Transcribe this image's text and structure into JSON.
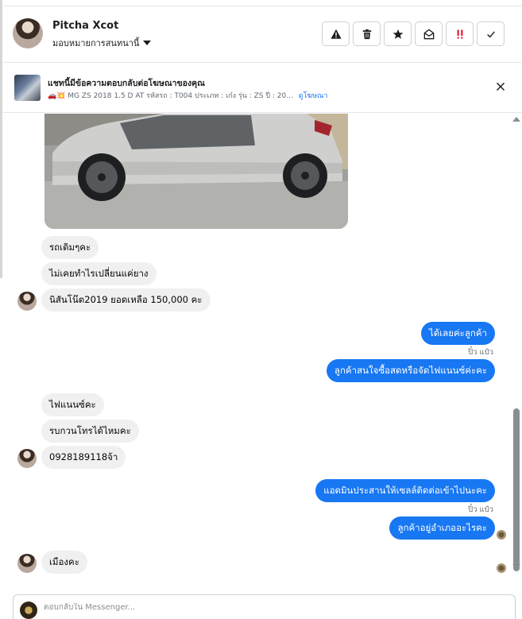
{
  "header": {
    "contact_name": "Pitcha Xcot",
    "assign_label": "มอบหมายการสนทนานี้",
    "actions": [
      {
        "name": "spam-button",
        "icon": "warning-icon"
      },
      {
        "name": "delete-button",
        "icon": "trash-icon"
      },
      {
        "name": "star-button",
        "icon": "star-icon"
      },
      {
        "name": "mark-unread-button",
        "icon": "envelope-open-icon"
      },
      {
        "name": "follow-up-button",
        "icon": "double-exclamation-icon",
        "color": "#e41e3f"
      },
      {
        "name": "done-button",
        "icon": "check-icon"
      }
    ]
  },
  "ad_banner": {
    "title": "แชทนี้มีข้อความตอบกลับต่อโฆษณาของคุณ",
    "description": "🚗💥 MG ZS 2018 1.5 D AT รหัสรถ : T004 ประเภท : เก๋ง รุ่น : ZS ปี : 20...",
    "link_label": "ดูโฆษณา"
  },
  "messages": {
    "m1": "รถเดิมๆคะ",
    "m2": "ไม่เคยทำไรเปลี่ยนแค่ยาง",
    "m3": "นิสันโน๊ต2019 ยอดเหลือ 150,000 คะ",
    "m4": "ได้เลยค่ะลูกค้า",
    "seen1": "ปิ๋ว แป๋ว",
    "m5": "ลูกค้าสนใจซื้อสดหรือจัดไฟแนนซ์ค่ะคะ",
    "m6": "ไฟแนนซ์คะ",
    "m7": "รบกวนโทรได้ไหมคะ",
    "m8": "0928189118จ้า",
    "m9": "แอดมินประสานให้เซลล์ติดต่อเข้าไปนะคะ",
    "seen2": "ปิ๋ว แป๋ว",
    "m10": "ลูกค้าอยู่อำเภออะไรคะ",
    "m11": "เมืองคะ"
  },
  "reply": {
    "placeholder": "ตอบกลับใน Messenger..."
  },
  "colors": {
    "outgoing_bubble": "#1877f2",
    "incoming_bubble": "#f0f0f0",
    "link": "#1877f2"
  }
}
